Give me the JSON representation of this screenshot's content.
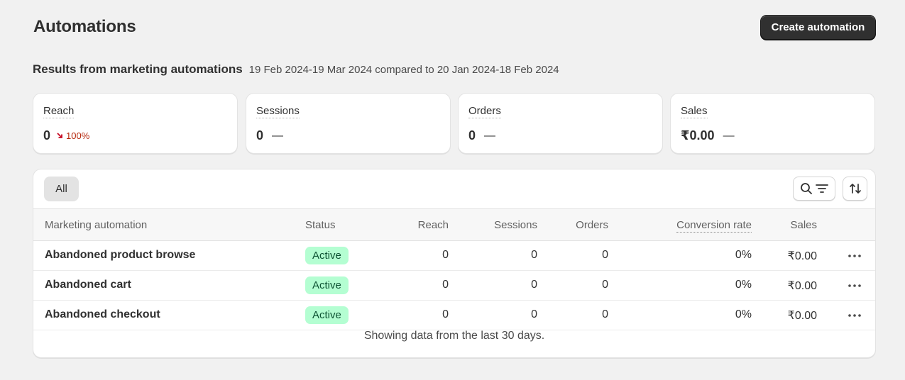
{
  "header": {
    "title": "Automations",
    "create_button_label": "Create automation"
  },
  "results": {
    "title": "Results from marketing automations",
    "date_range": "19 Feb 2024-19 Mar 2024 compared to 20 Jan 2024-18 Feb 2024"
  },
  "metrics": [
    {
      "label": "Reach",
      "value": "0",
      "change": "100%",
      "change_direction": "down",
      "change_color": "#b5260b"
    },
    {
      "label": "Sessions",
      "value": "0",
      "change": "—"
    },
    {
      "label": "Orders",
      "value": "0",
      "change": "—"
    },
    {
      "label": "Sales",
      "value": "₹0.00",
      "change": "—"
    }
  ],
  "table": {
    "filter_tab": "All",
    "tools": {
      "search_filter_icon": "search-filter-icon",
      "sort_icon": "sort-icon"
    },
    "columns": [
      "Marketing automation",
      "Status",
      "Reach",
      "Sessions",
      "Orders",
      "Conversion rate",
      "Sales"
    ],
    "rows": [
      {
        "name": "Abandoned product browse",
        "status": "Active",
        "reach": "0",
        "sessions": "0",
        "orders": "0",
        "conversion_rate": "0%",
        "sales": "₹0.00"
      },
      {
        "name": "Abandoned cart",
        "status": "Active",
        "reach": "0",
        "sessions": "0",
        "orders": "0",
        "conversion_rate": "0%",
        "sales": "₹0.00"
      },
      {
        "name": "Abandoned checkout",
        "status": "Active",
        "reach": "0",
        "sessions": "0",
        "orders": "0",
        "conversion_rate": "0%",
        "sales": "₹0.00"
      }
    ],
    "footer": "Showing data from the last 30 days.",
    "status_badge_color": "#b4fed2"
  }
}
